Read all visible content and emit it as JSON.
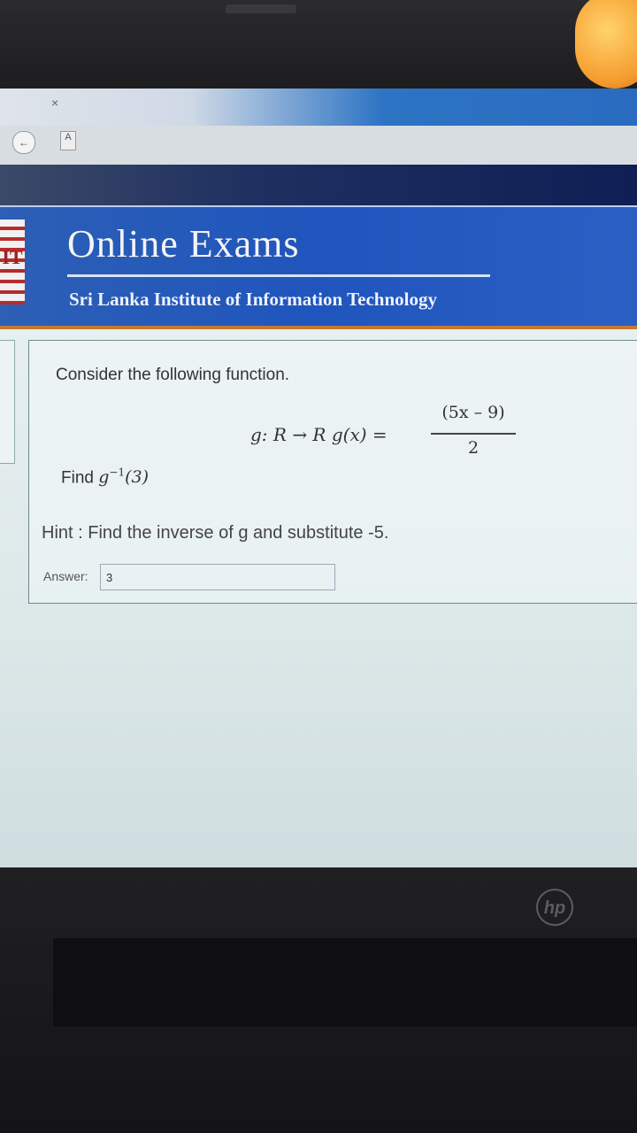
{
  "browser": {
    "tab_close": "×",
    "doc_icon_letter": "A"
  },
  "header": {
    "title": "Online Exams",
    "subtitle": "Sri Lanka Institute of Information Technology",
    "logo_text": "IT"
  },
  "question": {
    "intro": "Consider the following function.",
    "formula_left": "g: R → R   g(x) =",
    "formula_numerator": "(5x – 9)",
    "formula_denominator": "2",
    "find_prefix": "Find ",
    "find_func": "g",
    "find_exp": "−1",
    "find_arg": "(3)",
    "hint": "Hint : Find the inverse of g and substitute -5."
  },
  "answer": {
    "label": "Answer:",
    "value": "3"
  },
  "device": {
    "brand": "hp"
  },
  "colors": {
    "header_blue": "#1f55bd",
    "accent_orange": "#c47a2e"
  }
}
